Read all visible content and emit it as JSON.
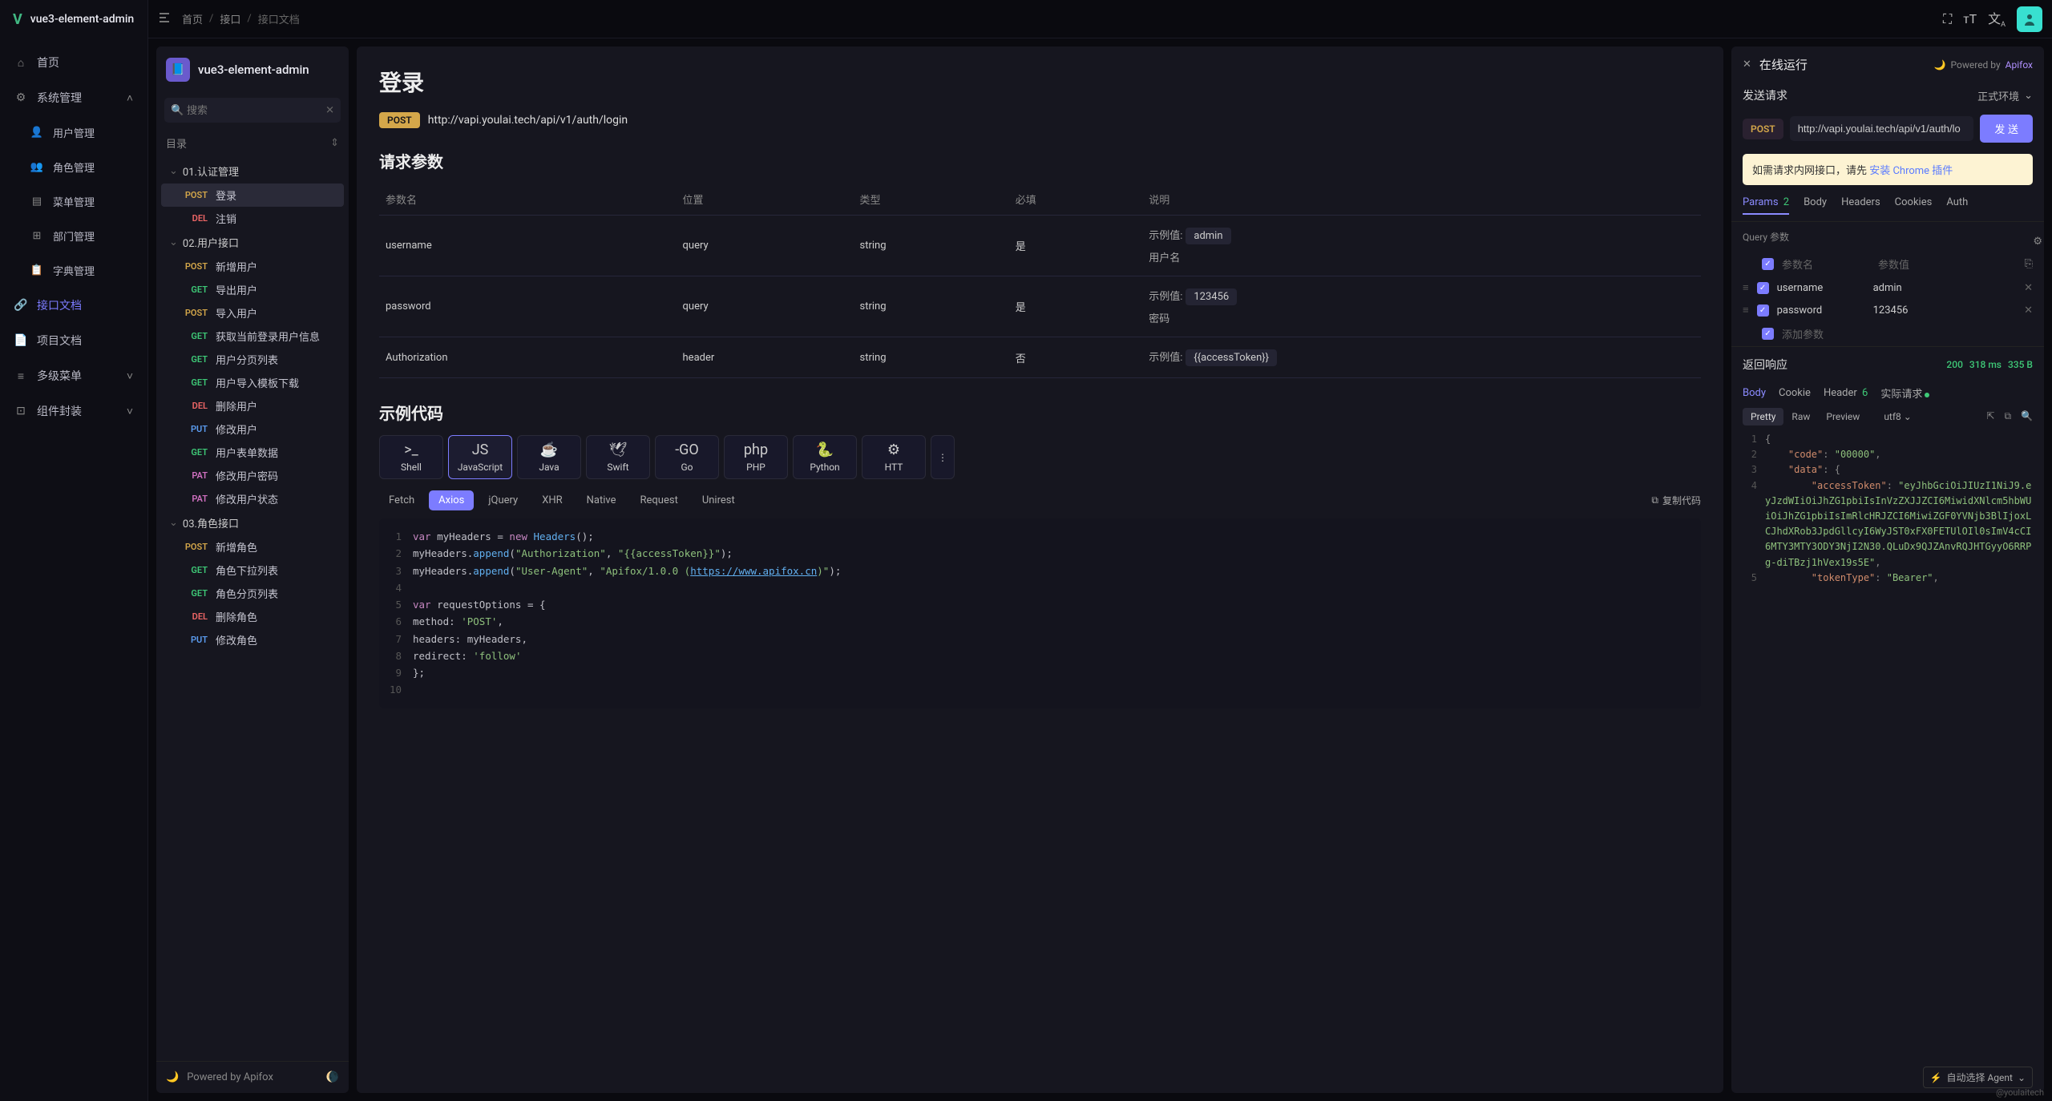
{
  "app": {
    "name": "vue3-element-admin"
  },
  "breadcrumb": [
    "首页",
    "接口",
    "接口文档"
  ],
  "nav": [
    {
      "icon": "home",
      "label": "首页"
    },
    {
      "icon": "gear",
      "label": "系统管理",
      "expand": true,
      "children": [
        {
          "icon": "user",
          "label": "用户管理"
        },
        {
          "icon": "role",
          "label": "角色管理"
        },
        {
          "icon": "menu",
          "label": "菜单管理"
        },
        {
          "icon": "dept",
          "label": "部门管理"
        },
        {
          "icon": "dict",
          "label": "字典管理"
        }
      ]
    },
    {
      "icon": "link",
      "label": "接口文档",
      "active": true
    },
    {
      "icon": "doc",
      "label": "项目文档"
    },
    {
      "icon": "multi",
      "label": "多级菜单",
      "chevron": true
    },
    {
      "icon": "comp",
      "label": "组件封装",
      "chevron": true
    }
  ],
  "doc": {
    "title": "vue3-element-admin",
    "search_placeholder": "搜索",
    "dir_label": "目录",
    "groups": [
      {
        "name": "01.认证管理",
        "items": [
          {
            "method": "POST",
            "label": "登录",
            "selected": true
          },
          {
            "method": "DEL",
            "label": "注销"
          }
        ]
      },
      {
        "name": "02.用户接口",
        "items": [
          {
            "method": "POST",
            "label": "新增用户"
          },
          {
            "method": "GET",
            "label": "导出用户"
          },
          {
            "method": "POST",
            "label": "导入用户"
          },
          {
            "method": "GET",
            "label": "获取当前登录用户信息"
          },
          {
            "method": "GET",
            "label": "用户分页列表"
          },
          {
            "method": "GET",
            "label": "用户导入模板下载"
          },
          {
            "method": "DEL",
            "label": "删除用户"
          },
          {
            "method": "PUT",
            "label": "修改用户"
          },
          {
            "method": "GET",
            "label": "用户表单数据"
          },
          {
            "method": "PAT",
            "label": "修改用户密码"
          },
          {
            "method": "PAT",
            "label": "修改用户状态"
          }
        ]
      },
      {
        "name": "03.角色接口",
        "items": [
          {
            "method": "POST",
            "label": "新增角色"
          },
          {
            "method": "GET",
            "label": "角色下拉列表"
          },
          {
            "method": "GET",
            "label": "角色分页列表"
          },
          {
            "method": "DEL",
            "label": "删除角色"
          },
          {
            "method": "PUT",
            "label": "修改角色"
          }
        ]
      }
    ],
    "footer": "Powered by Apifox"
  },
  "api": {
    "title": "登录",
    "method": "POST",
    "url": "http://vapi.youlai.tech/api/v1/auth/login",
    "params_heading": "请求参数",
    "columns": [
      "参数名",
      "位置",
      "类型",
      "必填",
      "说明"
    ],
    "params": [
      {
        "name": "username",
        "loc": "query",
        "type": "string",
        "req": "是",
        "desc_label": "示例值:",
        "ex": "admin",
        "desc2": "用户名"
      },
      {
        "name": "password",
        "loc": "query",
        "type": "string",
        "req": "是",
        "desc_label": "示例值:",
        "ex": "123456",
        "desc2": "密码"
      },
      {
        "name": "Authorization",
        "loc": "header",
        "type": "string",
        "req": "否",
        "desc_label": "示例值:",
        "ex": "{{accessToken}}",
        "desc2": ""
      }
    ],
    "code_heading": "示例代码",
    "code_langs": [
      "Shell",
      "JavaScript",
      "Java",
      "Swift",
      "Go",
      "PHP",
      "Python",
      "HTT"
    ],
    "code_active": "JavaScript",
    "code_subs": [
      "Fetch",
      "Axios",
      "jQuery",
      "XHR",
      "Native",
      "Request",
      "Unirest"
    ],
    "code_sub_active": "Axios",
    "copy_label": "复制代码",
    "code_lines": [
      {
        "n": 1,
        "seg": [
          [
            "kw",
            "var"
          ],
          [
            "",
            " myHeaders = "
          ],
          [
            "kw",
            "new"
          ],
          [
            "",
            " "
          ],
          [
            "fn",
            "Headers"
          ],
          [
            "",
            "();"
          ]
        ]
      },
      {
        "n": 2,
        "seg": [
          [
            "",
            "myHeaders."
          ],
          [
            "fn",
            "append"
          ],
          [
            "",
            "("
          ],
          [
            "str",
            "\"Authorization\""
          ],
          [
            "",
            ", "
          ],
          [
            "str",
            "\"{{accessToken}}\""
          ],
          [
            "",
            ");"
          ]
        ]
      },
      {
        "n": 3,
        "seg": [
          [
            "",
            "myHeaders."
          ],
          [
            "fn",
            "append"
          ],
          [
            "",
            "("
          ],
          [
            "str",
            "\"User-Agent\""
          ],
          [
            "",
            ", "
          ],
          [
            "str",
            "\"Apifox/1.0.0 ("
          ],
          [
            "lnk",
            "https://www.apifox.cn"
          ],
          [
            "str",
            ")\""
          ],
          [
            "",
            ");"
          ]
        ]
      },
      {
        "n": 4,
        "seg": [
          [
            "",
            ""
          ]
        ]
      },
      {
        "n": 5,
        "seg": [
          [
            "kw",
            "var"
          ],
          [
            "",
            " requestOptions = {"
          ]
        ]
      },
      {
        "n": 6,
        "seg": [
          [
            "",
            "   method: "
          ],
          [
            "str",
            "'POST'"
          ],
          [
            "",
            ","
          ]
        ]
      },
      {
        "n": 7,
        "seg": [
          [
            "",
            "   headers: myHeaders,"
          ]
        ]
      },
      {
        "n": 8,
        "seg": [
          [
            "",
            "   redirect: "
          ],
          [
            "str",
            "'follow'"
          ]
        ]
      },
      {
        "n": 9,
        "seg": [
          [
            "",
            "};"
          ]
        ]
      },
      {
        "n": 10,
        "seg": [
          [
            "",
            ""
          ]
        ]
      }
    ]
  },
  "run": {
    "title": "在线运行",
    "powered": "Powered by",
    "powered_by": "Apifox",
    "send_heading": "发送请求",
    "env": "正式环境",
    "method": "POST",
    "url": "http://vapi.youlai.tech/api/v1/auth/lo",
    "send": "发 送",
    "alert_pre": "如需请求内网接口，请先 ",
    "alert_link": "安装 Chrome 插件",
    "tabs": [
      {
        "l": "Params",
        "cnt": "2",
        "active": true
      },
      {
        "l": "Body"
      },
      {
        "l": "Headers"
      },
      {
        "l": "Cookies"
      },
      {
        "l": "Auth"
      }
    ],
    "query_label": "Query 参数",
    "pname_ph": "参数名",
    "pval_ph": "参数值",
    "addp": "添加参数",
    "prows": [
      {
        "name": "username",
        "val": "admin"
      },
      {
        "name": "password",
        "val": "123456"
      }
    ],
    "resp_heading": "返回响应",
    "status": "200",
    "time": "318 ms",
    "size": "335 B",
    "rtabs": [
      {
        "l": "Body",
        "active": true
      },
      {
        "l": "Cookie"
      },
      {
        "l": "Header",
        "cnt": "6"
      },
      {
        "l": "实际请求",
        "dot": true
      }
    ],
    "views": [
      "Pretty",
      "Raw",
      "Preview"
    ],
    "view_active": "Pretty",
    "enc": "utf8",
    "json": [
      {
        "n": 1,
        "indent": 0,
        "p": "{"
      },
      {
        "n": 2,
        "indent": 1,
        "k": "\"code\"",
        "c": ": ",
        "s": "\"00000\"",
        "t": ","
      },
      {
        "n": 3,
        "indent": 1,
        "k": "\"data\"",
        "c": ": ",
        "p": "{"
      },
      {
        "n": 4,
        "indent": 2,
        "k": "\"accessToken\"",
        "c": ": ",
        "s": "\"eyJhbGciOiJIUzI1NiJ9.eyJzdWIiOiJhZG1pbiIsInVzZXJJZCI6MiwidXNlcm5hbWUiOiJhZG1pbiIsImRlcHRJZCI6MiwiZGF0YVNjb3BlIjoxLCJhdXRob3JpdGllcyI6WyJST0xFX0FETUlOIl0sImV4cCI6MTY3MTY3ODY3NjI2N30.QLuDx9QJZAnvRQJHTGyyO6RRPg-diTBzj1hVex19s5E\"",
        "t": ","
      },
      {
        "n": 5,
        "indent": 2,
        "k": "\"tokenType\"",
        "c": ": ",
        "s": "\"Bearer\"",
        "t": ","
      }
    ],
    "agent": "自动选择 Agent"
  },
  "watermark": "@youlaitech"
}
